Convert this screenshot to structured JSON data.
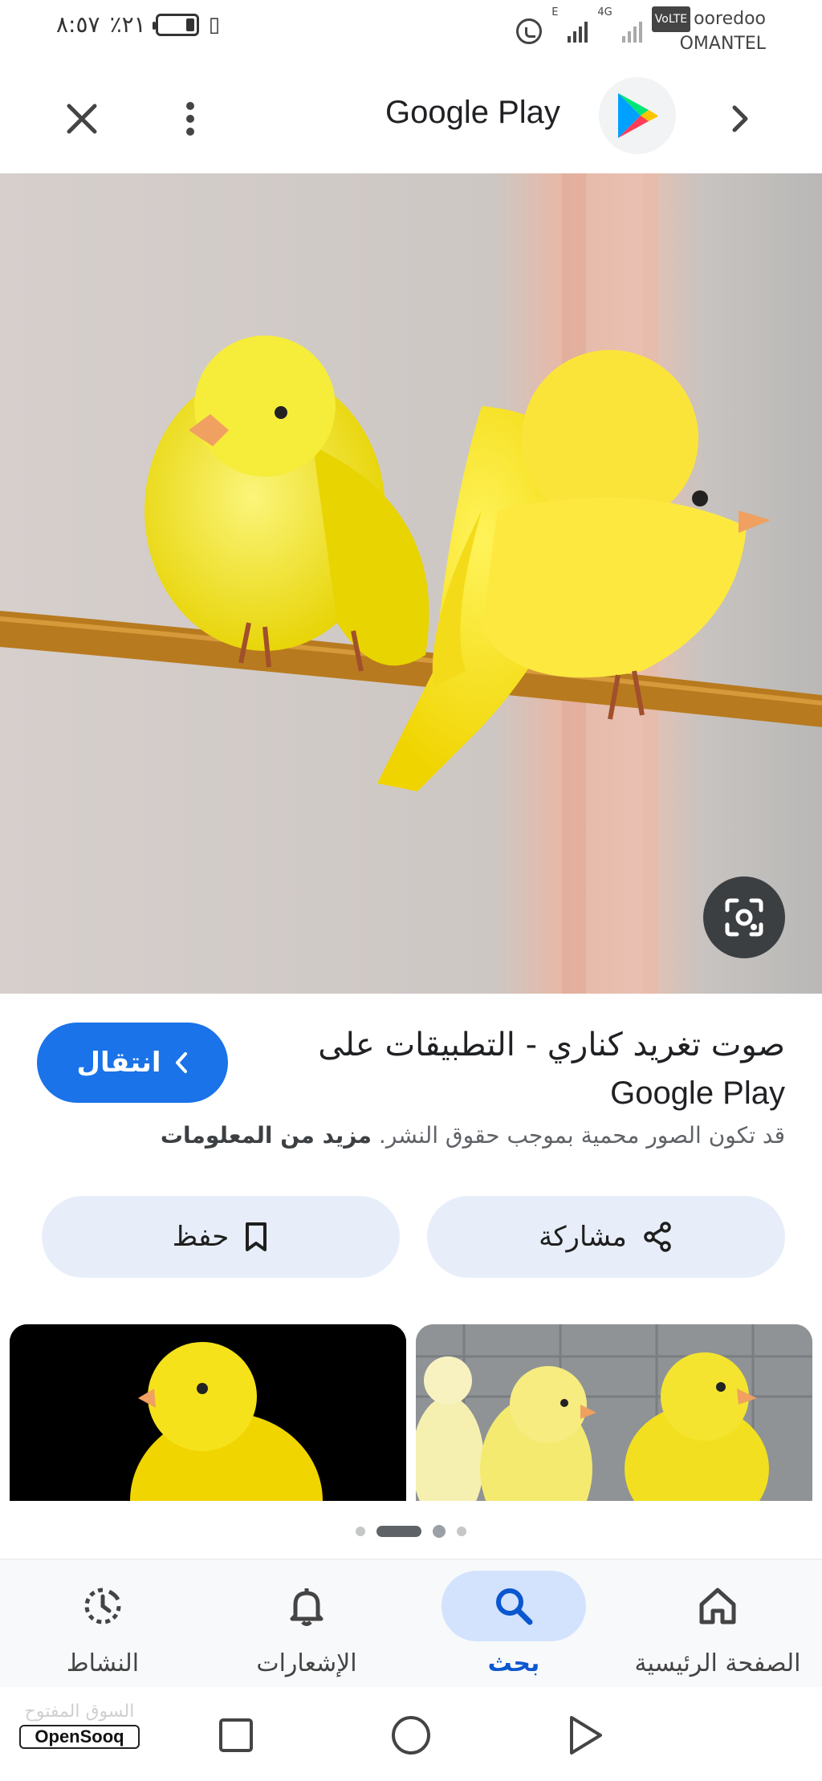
{
  "status_bar": {
    "time": "٨:٥٧",
    "battery": "٪٢١",
    "battery_level": 0.21,
    "carrier_top": "ooredoo",
    "carrier_bottom": "OMANTEL",
    "volte_label": "VoLTE",
    "net_e": "E",
    "net_4g": "4G"
  },
  "app_bar": {
    "title": "Google Play",
    "close_icon": "close-icon",
    "more_icon": "more-vert-icon",
    "next_icon": "chevron-right-icon"
  },
  "result": {
    "visit_label": "انتقال",
    "title_ar": "صوت تغريد كناري - التطبيقات على",
    "title_src": "Google Play",
    "copyright_text": "قد تكون الصور محمية بموجب حقوق النشر.",
    "more_info": "مزيد من المعلومات",
    "share_label": "مشاركة",
    "save_label": "حفظ"
  },
  "carousel": {
    "page_count": 4,
    "active_index": 1
  },
  "bottom_nav": {
    "items": [
      {
        "label": "الصفحة الرئيسية",
        "icon": "home-icon"
      },
      {
        "label": "بحث",
        "icon": "search-icon",
        "active": true
      },
      {
        "label": "الإشعارات",
        "icon": "bell-icon"
      },
      {
        "label": "النشاط",
        "icon": "activity-icon"
      }
    ]
  },
  "watermark": {
    "ar": "السوق المفتوح",
    "en": "OpenSooq"
  },
  "colors": {
    "accent": "#1a73e8",
    "active_nav": "#0b57d0",
    "canary_yellow": "#f5e400"
  }
}
